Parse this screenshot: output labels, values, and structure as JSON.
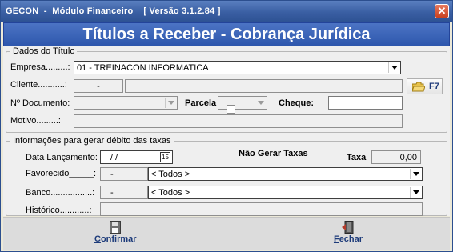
{
  "window": {
    "title": "GECON  -  Módulo Financeiro    [ Versão 3.1.2.84 ]",
    "close_glyph": "✕"
  },
  "banner": {
    "title": "Títulos a Receber - Cobrança Jurídica"
  },
  "dados": {
    "group_title": "Dados do Título",
    "empresa_label": "Empresa.........:",
    "empresa_value": "01 - TREINACON INFORMATICA",
    "cliente_label": "Cliente...........:",
    "cliente_code": "-",
    "cliente_name": "",
    "f7_label": "F7",
    "documento_label": "Nº Documento:",
    "documento_value": "",
    "parcela_label": "Parcela",
    "parcela_value": "",
    "cheque_label": "Cheque:",
    "cheque_value": "",
    "motivo_label": "Motivo.........:",
    "motivo_value": ""
  },
  "taxas": {
    "group_title": "Informações para gerar débito das taxas",
    "data_label": "Data Lançamento:",
    "data_value": "/ /",
    "nao_gerar_label": "Não Gerar Taxas",
    "nao_gerar_checked": false,
    "taxa_label": "Taxa",
    "taxa_value": "0,00",
    "favorecido_label": "Favorecido_____:",
    "favorecido_code": "-",
    "favorecido_value": "< Todos >",
    "banco_label": "Banco.................:",
    "banco_code": "-",
    "banco_value": "< Todos >",
    "historico_label": "Histórico............:",
    "historico_value": ""
  },
  "footer": {
    "confirmar_first": "C",
    "confirmar_rest": "onfirmar",
    "fechar_first": "F",
    "fechar_rest": "echar"
  },
  "colors": {
    "titlebar": "#3a5fa3",
    "banner": "#2e57ad",
    "button_text": "#1d3b7a",
    "close": "#c8401f"
  },
  "icons": [
    "close-icon",
    "folder-icon",
    "calendar-icon",
    "floppy-disk-icon",
    "exit-door-icon",
    "dropdown-arrow-icon"
  ]
}
